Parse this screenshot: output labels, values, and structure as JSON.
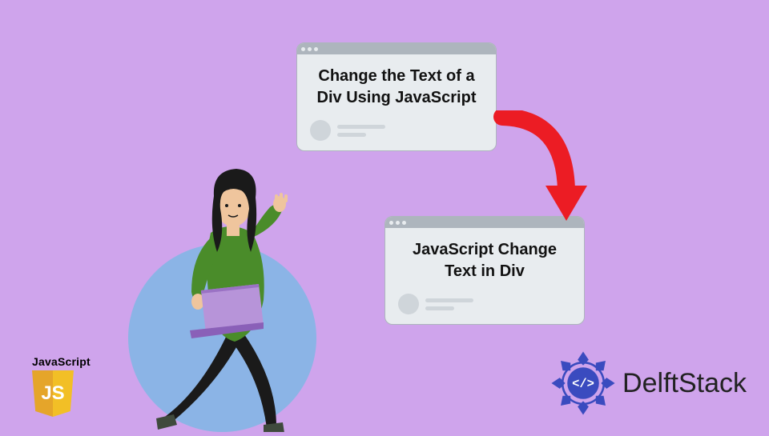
{
  "cards": {
    "a": {
      "text": "Change the Text of a Div Using JavaScript"
    },
    "b": {
      "text": "JavaScript Change Text in Div"
    }
  },
  "js_badge": {
    "label": "JavaScript",
    "letters": "JS"
  },
  "brand": {
    "name": "DelftStack"
  },
  "colors": {
    "bg": "#cfa4ec",
    "circle": "#8bb4e6",
    "card_bg": "#e8ecef",
    "card_bar": "#adb5bd",
    "arrow": "#ec1c24",
    "js_gold_dark": "#e5a52a",
    "js_gold_light": "#f2bf26",
    "brand_blue": "#3a4bbf"
  }
}
